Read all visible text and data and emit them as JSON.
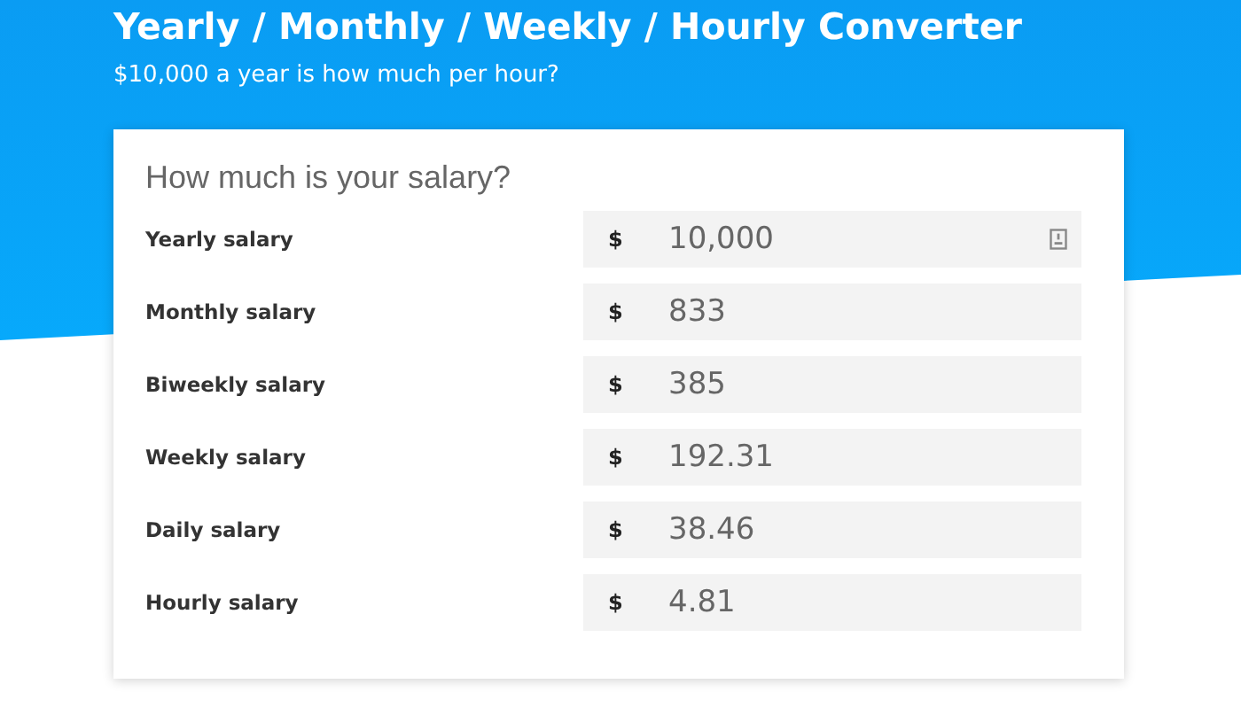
{
  "header": {
    "title": "Yearly / Monthly / Weekly / Hourly Converter",
    "subtitle": "$10,000 a year is how much per hour?"
  },
  "card": {
    "heading": "How much is your salary?",
    "rows": [
      {
        "label": "Yearly salary",
        "currency": "$",
        "value": "10,000",
        "kind": "with-icon"
      },
      {
        "label": "Monthly salary",
        "currency": "$",
        "value": "833",
        "kind": "plain"
      },
      {
        "label": "Biweekly salary",
        "currency": "$",
        "value": "385",
        "kind": "plain"
      },
      {
        "label": "Weekly salary",
        "currency": "$",
        "value": "192.31",
        "kind": "plain"
      },
      {
        "label": "Daily salary",
        "currency": "$",
        "value": "38.46",
        "kind": "plain"
      },
      {
        "label": "Hourly salary",
        "currency": "$",
        "value": "4.81",
        "kind": "plain"
      }
    ]
  }
}
